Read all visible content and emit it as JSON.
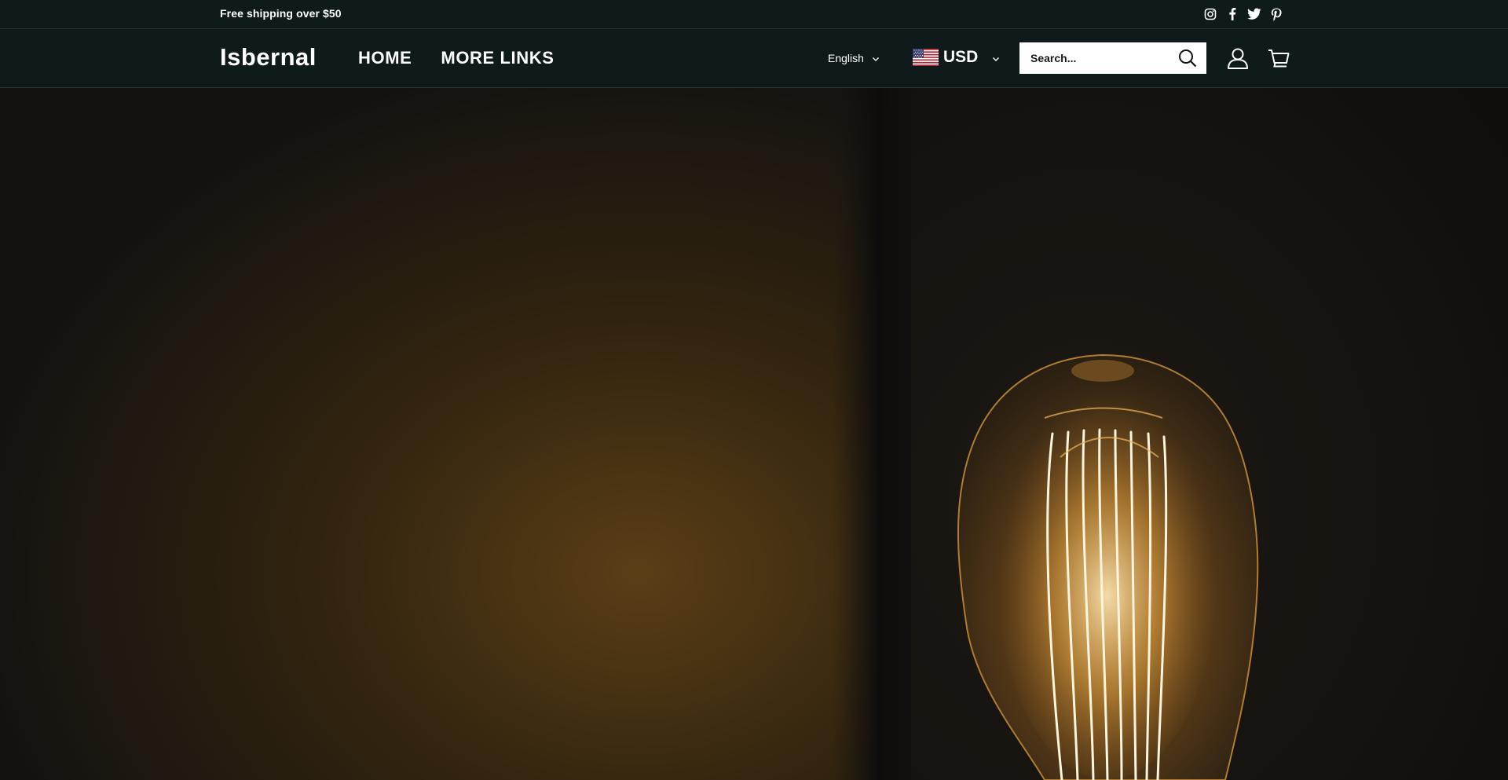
{
  "announcement": {
    "text": "Free shipping over $50",
    "social_icons": [
      "instagram-icon",
      "facebook-icon",
      "twitter-icon",
      "pinterest-icon"
    ]
  },
  "header": {
    "logo": "Isbernal",
    "nav": [
      {
        "label": "HOME"
      },
      {
        "label": "MORE LINKS"
      }
    ],
    "language": {
      "selected": "English"
    },
    "currency": {
      "selected": "USD",
      "flag_icon": "us-flag-icon"
    },
    "search": {
      "placeholder": "Search..."
    },
    "icons": [
      "account-icon",
      "cart-icon"
    ]
  },
  "hero": {
    "image": "vintage-edison-bulb-photo"
  },
  "colors": {
    "header_bg": "#0f1a1b",
    "text": "#ffffff",
    "hero_glow": "#6b4a1c"
  }
}
